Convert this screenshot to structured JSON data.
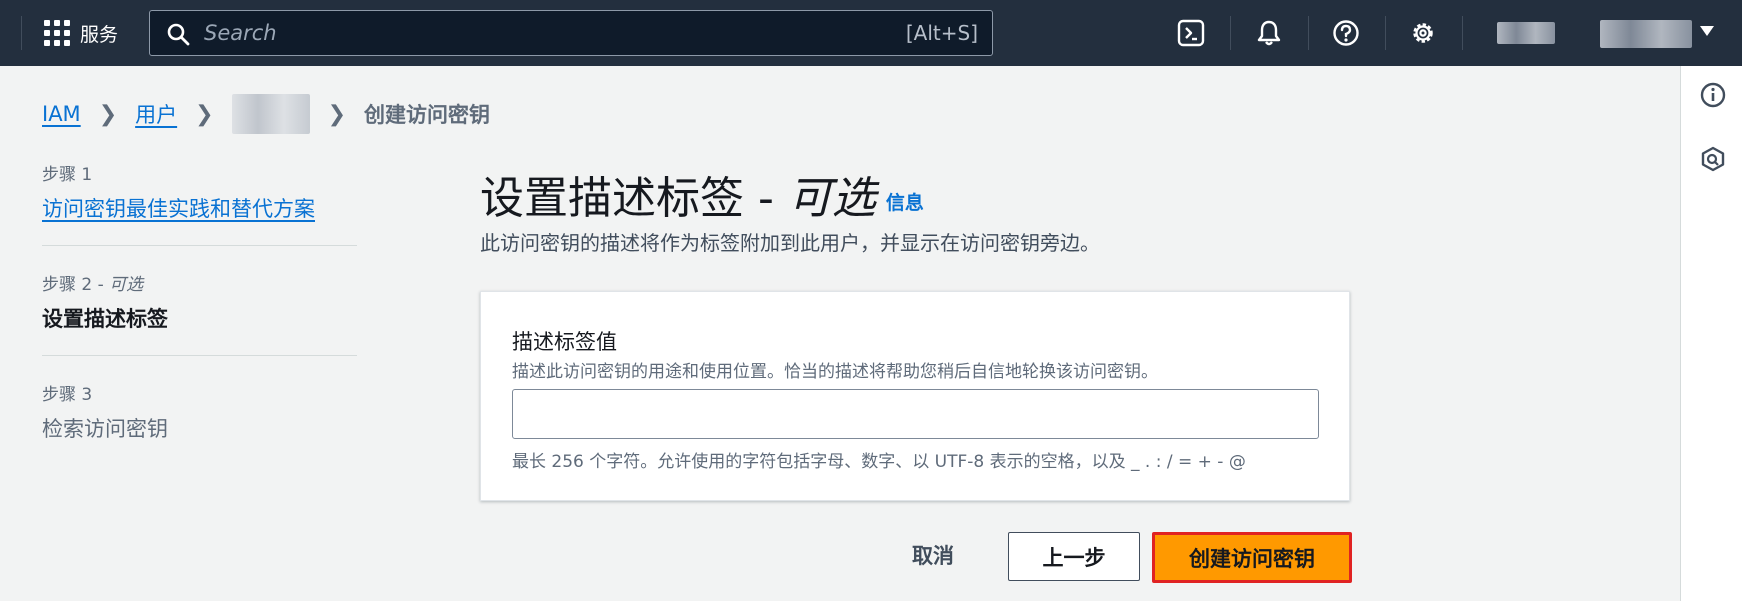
{
  "topbar": {
    "services_label": "服务",
    "search_placeholder": "Search",
    "search_shortcut": "[Alt+S]",
    "icons": [
      "cloudshell-icon",
      "bell-icon",
      "help-icon",
      "gear-icon"
    ]
  },
  "breadcrumb": {
    "items": [
      "IAM",
      "用户"
    ],
    "current": "创建访问密钥"
  },
  "steps": [
    {
      "number": "步骤 1",
      "title": "访问密钥最佳实践和替代方案"
    },
    {
      "number": "步骤 2 - ",
      "number_optional": "可选",
      "title": "设置描述标签"
    },
    {
      "number": "步骤 3",
      "title": "检索访问密钥"
    }
  ],
  "main": {
    "title": "设置描述标签 - ",
    "title_optional": "可选",
    "info_link": "信息",
    "description": "此访问密钥的描述将作为标签附加到此用户，并显示在访问密钥旁边。"
  },
  "form": {
    "label": "描述标签值",
    "description": "描述此访问密钥的用途和使用位置。恰当的描述将帮助您稍后自信地轮换该访问密钥。",
    "value": "",
    "constraint": "最长 256 个字符。允许使用的字符包括字母、数字、以 UTF-8 表示的空格，以及 _ . : / = + - @"
  },
  "actions": {
    "cancel": "取消",
    "previous": "上一步",
    "create": "创建访问密钥"
  },
  "colors": {
    "topbar": "#232f3e",
    "link": "#0972d3",
    "primary_button": "#ff9900",
    "highlight_border": "#e02222"
  }
}
